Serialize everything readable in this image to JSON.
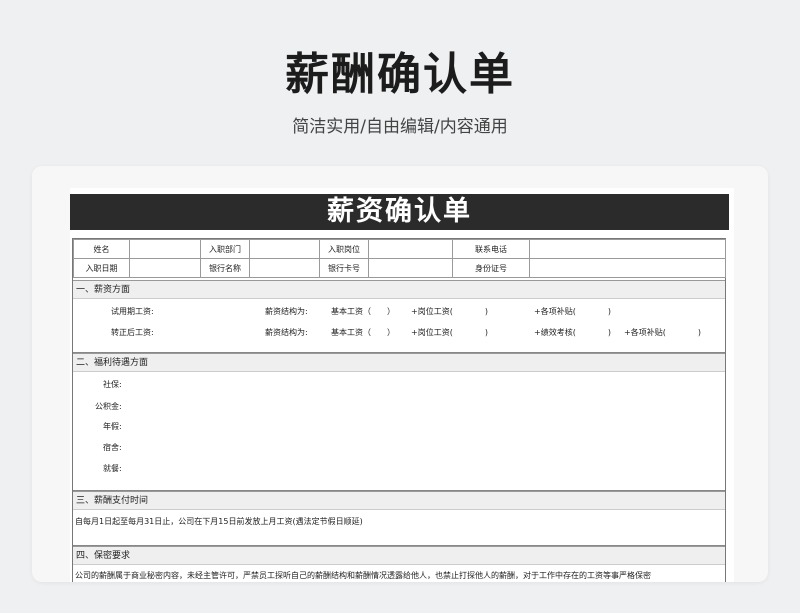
{
  "header": {
    "title": "薪酬确认单",
    "subtitle": "简洁实用/自由编辑/内容通用"
  },
  "doc": {
    "title": "薪资确认单",
    "info": {
      "row1": [
        "姓名",
        "",
        "入职部门",
        "",
        "入职岗位",
        "",
        "联系电话",
        ""
      ],
      "row2": [
        "入职日期",
        "",
        "银行名称",
        "",
        "银行卡号",
        "",
        "身份证号",
        ""
      ]
    },
    "salary": {
      "heading": "一、薪资方面",
      "trial_label": "试用期工资:",
      "trial_struct": "薪资结构为:",
      "trial_basic": "基本工资（　　）",
      "trial_post": "+岗位工资(　　　　)",
      "trial_allow": "+各项补贴(　　　　)",
      "regular_label": "转正后工资:",
      "regular_struct": "薪资结构为:",
      "regular_basic": "基本工资（　　）",
      "regular_post": "+岗位工资(　　　　)",
      "regular_perf": "+绩效考核(　　　　)",
      "regular_allow": "+各项补贴(　　　　)"
    },
    "benefits": {
      "heading": "二、福利待遇方面",
      "items": [
        "社保:",
        "公积金:",
        "年假:",
        "宿舍:",
        "就餐:"
      ]
    },
    "payment": {
      "heading": "三、薪酬支付时间",
      "text": "自每月1日起至每月31日止，公司在下月15日前发放上月工资(遇法定节假日顺延)"
    },
    "confidential": {
      "heading": "四、保密要求",
      "text": "公司的薪酬属于商业秘密内容，未经主管许可，严禁员工探听自己的薪酬结构和薪酬情况透露给他人，也禁止打探他人的薪酬，对于工作中存在的工资等事严格保密"
    }
  }
}
